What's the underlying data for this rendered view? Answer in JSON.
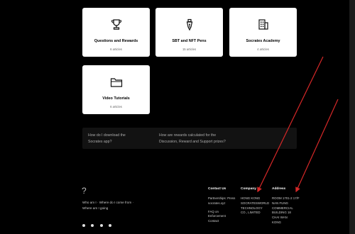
{
  "cards": [
    {
      "title": "Questions and Rewards",
      "sub": "6 articles",
      "icon": "trophy-icon"
    },
    {
      "title": "SBT and NFT Pens",
      "sub": "15 articles",
      "icon": "pen-nib-icon"
    },
    {
      "title": "Socrates Academy",
      "sub": "4 articles",
      "icon": "building-icon"
    },
    {
      "title": "Video Tutorials",
      "sub": "6 articles",
      "icon": "folder-icon"
    }
  ],
  "faq": {
    "q1": "How do I download the Socrates app?",
    "q2": "How are rewards calculated for the Discussion, Reward and Support prizes?"
  },
  "footer": {
    "logo": "?",
    "tagline": "Who am I · Where do I come from · Where am I going",
    "social_icons": [
      "twitter-icon",
      "youtube-icon",
      "discord-icon",
      "telegram-icon"
    ],
    "contact": {
      "heading": "Contact Us",
      "lines": [
        "Partnerships: Press",
        "socrates.xyz",
        "",
        "FAQ on",
        "Enforcement",
        "Contact"
      ]
    },
    "company": {
      "heading": "Company",
      "lines": [
        "HONG KONG",
        "SOCRATESWORLD",
        "TECHNOLOGY",
        "CO., LIMITED"
      ]
    },
    "address": {
      "heading": "Address",
      "lines": [
        "ROOM 1701-2 17/F",
        "NAN FUNG",
        "COMMERCIAL",
        "BUILDING 18",
        "CHAI WAN",
        "KONG"
      ]
    }
  },
  "colors": {
    "background": "#000000",
    "card": "#ffffff",
    "arrow": "#d62828",
    "faq_bg": "#121212"
  }
}
